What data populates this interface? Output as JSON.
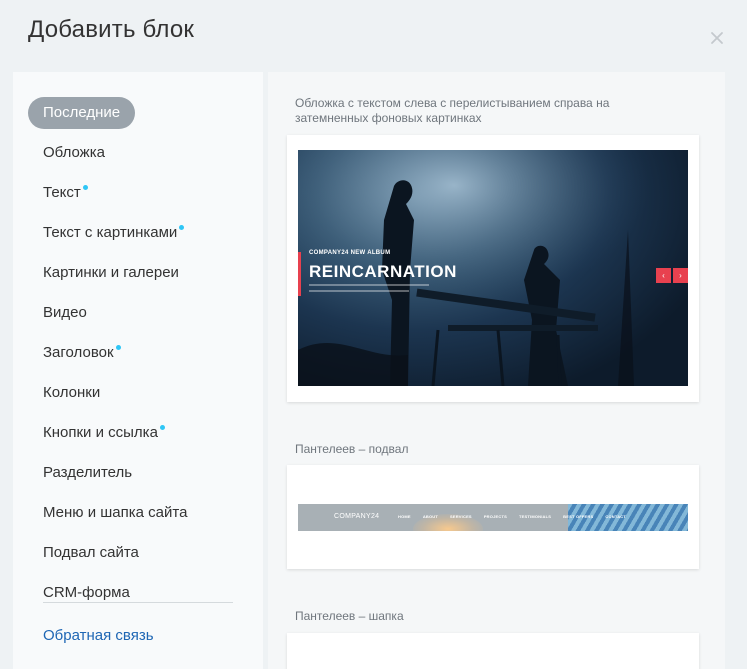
{
  "header": {
    "title": "Добавить блок"
  },
  "sidebar": {
    "items": [
      {
        "label": "Последние",
        "active": true,
        "new": false
      },
      {
        "label": "Обложка",
        "active": false,
        "new": false
      },
      {
        "label": "Текст",
        "active": false,
        "new": true
      },
      {
        "label": "Текст с картинками",
        "active": false,
        "new": true
      },
      {
        "label": "Картинки и галереи",
        "active": false,
        "new": false
      },
      {
        "label": "Видео",
        "active": false,
        "new": false
      },
      {
        "label": "Заголовок",
        "active": false,
        "new": true
      },
      {
        "label": "Колонки",
        "active": false,
        "new": false
      },
      {
        "label": "Кнопки и ссылка",
        "active": false,
        "new": true
      },
      {
        "label": "Разделитель",
        "active": false,
        "new": false
      },
      {
        "label": "Меню и шапка сайта",
        "active": false,
        "new": false
      },
      {
        "label": "Подвал сайта",
        "active": false,
        "new": false
      },
      {
        "label": "CRM-форма",
        "active": false,
        "new": false
      }
    ],
    "feedback": "Обратная связь"
  },
  "blocks": [
    {
      "label": "Обложка с текстом слева с перелистыванием справа на затемненных фоновых картинках",
      "preview": {
        "subtitle": "COMPANY24 NEW ALBUM",
        "title": "REINCARNATION",
        "prev_arrow": "‹",
        "next_arrow": "›"
      }
    },
    {
      "label": "Пантелеев – подвал",
      "preview": {
        "logo": "COMPANY24",
        "menu": [
          "HOME",
          "ABOUT",
          "SERVICES",
          "PROJECTS",
          "TESTIMONIALS",
          "BEST OFFERS",
          "CONTACT"
        ]
      }
    },
    {
      "label": "Пантелеев – шапка"
    }
  ],
  "colors": {
    "accent_new_dot": "#2fc6f6",
    "active_pill": "#9aa3ab",
    "link": "#1e66b4",
    "preview_red": "#e8414f"
  }
}
